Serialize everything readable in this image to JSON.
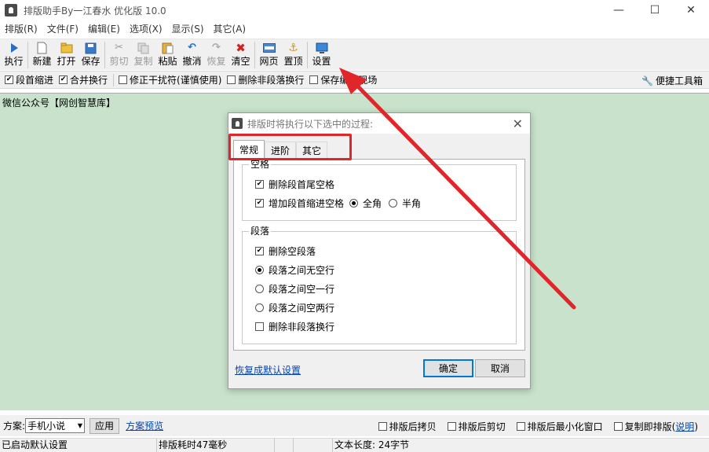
{
  "window": {
    "title": "排版助手By一江春水 优化版 10.0",
    "controls": {
      "minimize": "—",
      "maximize": "☐",
      "close": "✕"
    }
  },
  "menu": [
    "排版(R)",
    "文件(F)",
    "编辑(E)",
    "选项(X)",
    "显示(S)",
    "其它(A)"
  ],
  "toolbar": {
    "run": "执行",
    "new": "新建",
    "open": "打开",
    "save": "保存",
    "cut": "剪切",
    "copy": "复制",
    "paste": "粘贴",
    "undo": "撤消",
    "redo": "恢复",
    "clear": "清空",
    "webpage": "网页",
    "pin_top": "置顶",
    "settings": "设置"
  },
  "options": {
    "indent": {
      "label": "段首缩进",
      "checked": true
    },
    "merge_lines": {
      "label": "合并换行",
      "checked": true
    },
    "fix_interference": {
      "label": "修正干扰符(谨慎使用)",
      "checked": false
    },
    "remove_non_para": {
      "label": "删除非段落换行",
      "checked": false
    },
    "keep_scene": {
      "label": "保存编辑现场",
      "checked": false
    },
    "quick_tools": "便捷工具箱"
  },
  "editor": {
    "content": "微信公众号【网创智慧库】"
  },
  "bottom": {
    "scheme_label": "方案:",
    "scheme_value": "手机小说",
    "apply": "应用",
    "preview": "方案预览",
    "copy_after": "排版后拷贝",
    "cut_after": "排版后剪切",
    "minimize_after": "排版后最小化窗口",
    "copy_instant": "复制即排版(",
    "help": "说明",
    "help_close": ")"
  },
  "status": {
    "cell1": "已启动默认设置",
    "cell2": "排版耗时47毫秒",
    "cell3": "文本长度: 24字节"
  },
  "dialog": {
    "title": "排版时将执行以下选中的过程:",
    "tabs": [
      "常规",
      "进阶",
      "其它"
    ],
    "space_group": {
      "legend": "空格",
      "remove_trailing": {
        "label": "删除段首尾空格",
        "checked": true
      },
      "add_indent": {
        "label": "增加段首缩进空格",
        "checked": true
      },
      "full_width": "全角",
      "half_width": "半角",
      "selected_width": "全角"
    },
    "para_group": {
      "legend": "段落",
      "remove_empty": {
        "label": "删除空段落",
        "checked": true
      },
      "no_blank": "段落之间无空行",
      "one_blank": "段落之间空一行",
      "two_blank": "段落之间空两行",
      "selected_spacing": "段落之间无空行",
      "remove_non_para": {
        "label": "删除非段落换行",
        "checked": false
      }
    },
    "restore_default": "恢复成默认设置",
    "ok": "确定",
    "cancel": "取消"
  },
  "colors": {
    "editor_bg": "#c8e2cb",
    "annotation": "#e0252b",
    "link": "#0645ad"
  }
}
